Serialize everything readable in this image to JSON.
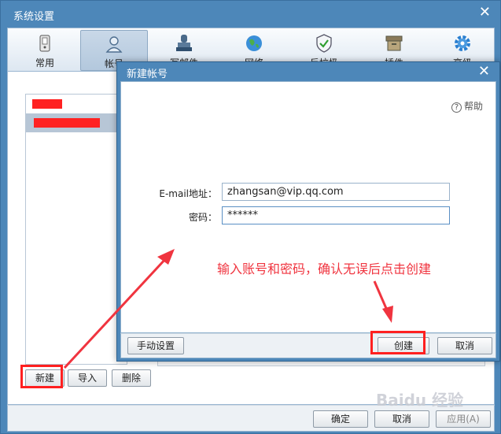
{
  "outer": {
    "title": "系统设置",
    "close": "✕",
    "toolbar": [
      {
        "label": "常用",
        "icon": "phone-icon"
      },
      {
        "label": "帐号",
        "icon": "user-icon"
      },
      {
        "label": "写邮件",
        "icon": "stamp-icon"
      },
      {
        "label": "网络",
        "icon": "globe-icon"
      },
      {
        "label": "反垃圾",
        "icon": "shield-icon"
      },
      {
        "label": "插件",
        "icon": "plugin-box-icon"
      },
      {
        "label": "高级",
        "icon": "gear-icon"
      }
    ],
    "account_buttons": {
      "new": "新建",
      "import": "导入",
      "delete": "删除"
    },
    "footer": {
      "ok": "确定",
      "cancel": "取消",
      "apply": "应用(A)"
    }
  },
  "dialog": {
    "title": "新建帐号",
    "close": "✕",
    "help": "帮助",
    "email_label": "E-mail地址：",
    "email_value": "zhangsan@vip.qq.com",
    "password_label": "密码：",
    "password_value": "******",
    "manual_button": "手动设置",
    "create_button": "创建",
    "cancel_button": "取消"
  },
  "annotation": {
    "text": "输入账号和密码，确认无误后点击创建",
    "color": "#f0343f"
  },
  "watermark": "Baidu 经验"
}
